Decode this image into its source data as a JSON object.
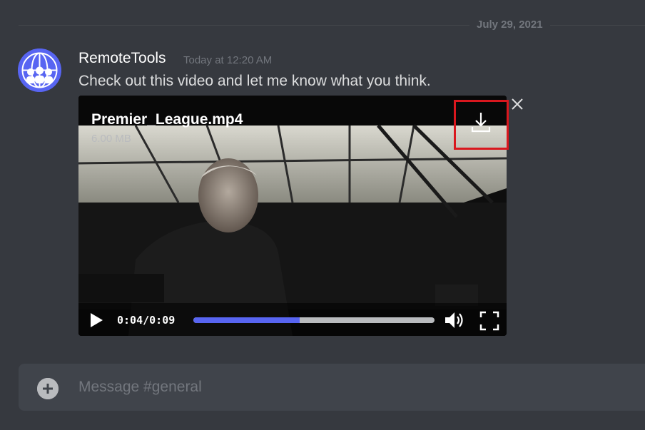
{
  "date_divider": "July 29, 2021",
  "message": {
    "author": "RemoteTools",
    "timestamp": "Today at 12:20 AM",
    "text": "Check out this video and let me know what you think."
  },
  "attachment": {
    "file_name": "Premier_League.mp4",
    "file_size": "6.00 MB",
    "current_time": "0:04",
    "separator": "/",
    "duration": "0:09",
    "progress_fraction": 0.44
  },
  "composer": {
    "placeholder": "Message #general"
  },
  "icons": {
    "avatar": "globe-people-avatar-icon",
    "download": "download-icon",
    "close": "close-icon",
    "play": "play-icon",
    "volume": "volume-icon",
    "fullscreen": "fullscreen-icon",
    "add": "plus-circle-icon"
  },
  "colors": {
    "background": "#36393f",
    "accent": "#5865f2",
    "highlight": "#d9171e"
  }
}
